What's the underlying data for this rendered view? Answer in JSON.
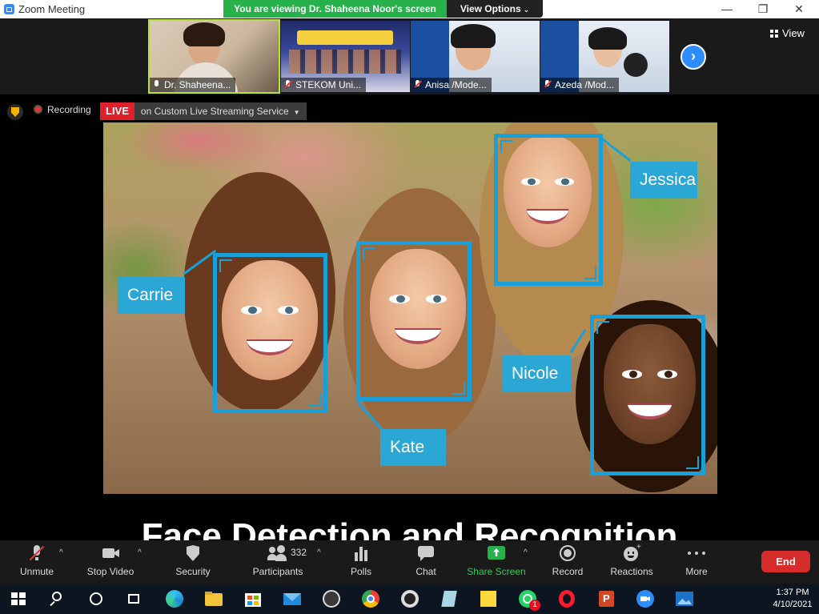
{
  "window": {
    "title": "Zoom Meeting",
    "viewing_banner": "You are viewing Dr. Shaheena Noor's screen",
    "view_options_label": "View Options",
    "minimize_glyph": "—",
    "maximize_glyph": "❐",
    "close_glyph": "✕"
  },
  "thumbnails": [
    {
      "name": "Dr. Shaheena...",
      "muted": false
    },
    {
      "name": "STEKOM Uni...",
      "muted": true
    },
    {
      "name": "Anisa /Mode...",
      "muted": true
    },
    {
      "name": "Azeda /Mod...",
      "muted": true
    }
  ],
  "view_button_label": "View",
  "next_glyph": "›",
  "recording": {
    "label": "Recording",
    "live_badge": "LIVE",
    "service": "on Custom Live Streaming Service"
  },
  "slide": {
    "names": {
      "carrie": "Carrie",
      "kate": "Kate",
      "jessica": "Jessica",
      "nicole": "Nicole"
    },
    "title": "Face Detection and Recognition"
  },
  "controls": {
    "unmute": "Unmute",
    "stop_video": "Stop Video",
    "security": "Security",
    "participants": "Participants",
    "participants_count": "332",
    "polls": "Polls",
    "chat": "Chat",
    "share_screen": "Share Screen",
    "record": "Record",
    "reactions": "Reactions",
    "more": "More",
    "end": "End"
  },
  "taskbar": {
    "time": "1:37 PM",
    "date": "4/10/2021",
    "whatsapp_badge": "1"
  },
  "colors": {
    "accent_green": "#27b14b",
    "live_red": "#e0202a",
    "zoom_blue": "#2d8cff",
    "detect_blue": "#1aa0d8"
  }
}
